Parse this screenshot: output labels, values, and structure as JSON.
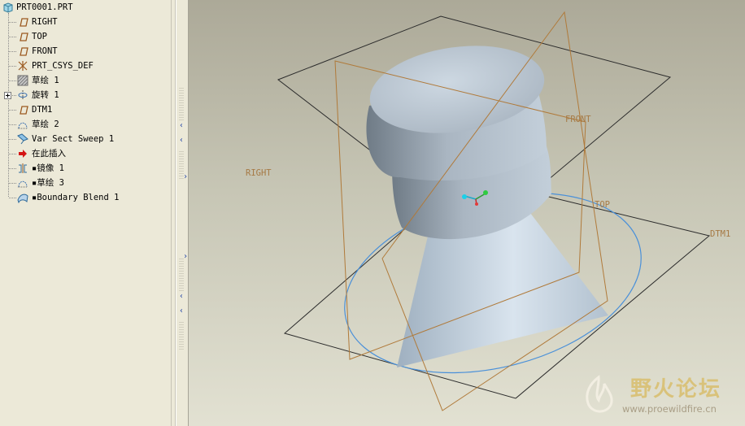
{
  "model_tree": {
    "root": "PRT0001.PRT",
    "items": [
      {
        "label": "RIGHT",
        "icon": "datum-plane-icon"
      },
      {
        "label": "TOP",
        "icon": "datum-plane-icon"
      },
      {
        "label": "FRONT",
        "icon": "datum-plane-icon"
      },
      {
        "label": "PRT_CSYS_DEF",
        "icon": "csys-icon"
      },
      {
        "label": "草绘 1",
        "icon": "sketch-hatched-icon"
      },
      {
        "label": "旋转 1",
        "icon": "revolve-icon"
      },
      {
        "label": "DTM1",
        "icon": "datum-plane-icon"
      },
      {
        "label": "草绘 2",
        "icon": "sketch-icon"
      },
      {
        "label": "Var Sect Sweep 1",
        "icon": "sweep-icon"
      },
      {
        "label": "在此插入",
        "icon": "insert-here-arrow-icon"
      },
      {
        "label": "▪镜像 1",
        "icon": "mirror-icon"
      },
      {
        "label": "▪草绘 3",
        "icon": "sketch-icon"
      },
      {
        "label": "▪Boundary Blend 1",
        "icon": "boundary-blend-icon"
      }
    ]
  },
  "viewport": {
    "datum_labels": {
      "right": "RIGHT",
      "front": "FRONT",
      "top": "TOP",
      "dtm1": "DTM1"
    },
    "colors": {
      "datum_plane": "#b07a3a",
      "datum_label": "#a67a45",
      "sketch_circle": "#4a90d9",
      "plane_outline": "#2b2b2b"
    }
  },
  "watermark": {
    "title": "野火论坛",
    "url": "www.proewildfire.cn"
  }
}
